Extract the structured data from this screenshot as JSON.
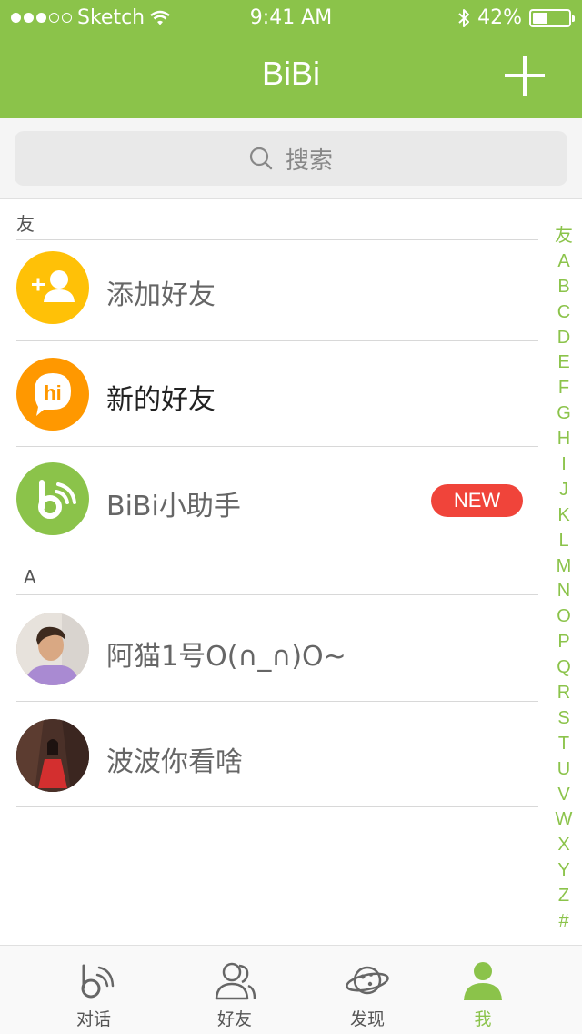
{
  "status_bar": {
    "carrier": "Sketch",
    "time": "9:41 AM",
    "battery_percent": "42%",
    "battery_level": 0.42,
    "signal_dots_filled": 3,
    "signal_dots_total": 5
  },
  "nav": {
    "title": "BiBi",
    "add_icon": "plus-icon"
  },
  "search": {
    "placeholder": "搜索",
    "icon": "search-icon"
  },
  "sections": {
    "friends_header": "友",
    "a_header": "A"
  },
  "rows": [
    {
      "label": "添加好友",
      "icon": "add-friend-icon",
      "color": "#ffc107"
    },
    {
      "label": "新的好友",
      "icon": "hi-chat-icon",
      "color": "#ff9800"
    },
    {
      "label": "BiBi小助手",
      "icon": "bibi-logo-icon",
      "color": "#8bc34a",
      "badge": "NEW"
    },
    {
      "label": "阿猫1号O(∩_∩)O~",
      "icon": "avatar-photo"
    },
    {
      "label": "波波你看啥",
      "icon": "avatar-photo"
    }
  ],
  "index_letters": [
    "友",
    "A",
    "B",
    "C",
    "D",
    "E",
    "F",
    "G",
    "H",
    "I",
    "J",
    "K",
    "L",
    "M",
    "N",
    "O",
    "P",
    "Q",
    "R",
    "S",
    "T",
    "U",
    "V",
    "W",
    "X",
    "Y",
    "Z",
    "#"
  ],
  "tabs": [
    {
      "label": "对话",
      "icon": "chat-bibi-icon"
    },
    {
      "label": "好友",
      "icon": "friends-icon"
    },
    {
      "label": "发现",
      "icon": "planet-icon"
    },
    {
      "label": "我",
      "icon": "profile-icon",
      "active": true
    }
  ],
  "colors": {
    "brand_green": "#8bc34a",
    "badge_red": "#f0443a",
    "add_friend_yellow": "#ffc107",
    "new_friend_orange": "#ff9800"
  }
}
